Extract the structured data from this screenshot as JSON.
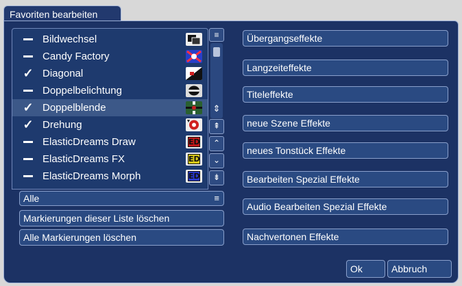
{
  "window": {
    "tab_title": "Favoriten bearbeiten"
  },
  "list": {
    "items": [
      {
        "label": "Bildwechsel",
        "mark": "dash",
        "selected": false,
        "thumb": "bildwechsel"
      },
      {
        "label": "Candy Factory",
        "mark": "dash",
        "selected": false,
        "thumb": "candy"
      },
      {
        "label": "Diagonal",
        "mark": "check",
        "selected": false,
        "thumb": "diagonal"
      },
      {
        "label": "Doppelbelichtung",
        "mark": "dash",
        "selected": false,
        "thumb": "doppelbelichtung"
      },
      {
        "label": "Doppelblende",
        "mark": "check",
        "selected": true,
        "thumb": "doppelblende"
      },
      {
        "label": "Drehung",
        "mark": "check",
        "selected": false,
        "thumb": "drehung"
      },
      {
        "label": "ElasticDreams Draw",
        "mark": "dash",
        "selected": false,
        "thumb": "ed-red",
        "badge": "ED"
      },
      {
        "label": "ElasticDreams FX",
        "mark": "dash",
        "selected": false,
        "thumb": "ed-yellow",
        "badge": "ED"
      },
      {
        "label": "ElasticDreams Morph",
        "mark": "dash",
        "selected": false,
        "thumb": "ed-blue",
        "badge": "ED"
      }
    ],
    "filter_label": "Alle",
    "clear_list_label": "Markierungen dieser Liste löschen",
    "clear_all_label": "Alle Markierungen löschen"
  },
  "scrollbar": {
    "icons": [
      "list-menu-icon",
      "scroll-thumb",
      "page-updown-icon",
      "scroll-top-icon",
      "scroll-up-icon",
      "scroll-down-icon",
      "scroll-bottom-icon"
    ]
  },
  "categories": [
    "Übergangseffekte",
    "Langzeiteffekte",
    "Titeleffekte",
    "neue Szene Effekte",
    "neues Tonstück Effekte",
    "Bearbeiten Spezial Effekte",
    "Audio Bearbeiten Spezial Effekte",
    "Nachvertonen Effekte"
  ],
  "footer": {
    "ok_label": "Ok",
    "cancel_label": "Abbruch"
  },
  "colors": {
    "panel": "#1c3264",
    "button": "#2a4a82",
    "selected_row": "#3c5888",
    "border": "#8aa0cc"
  }
}
